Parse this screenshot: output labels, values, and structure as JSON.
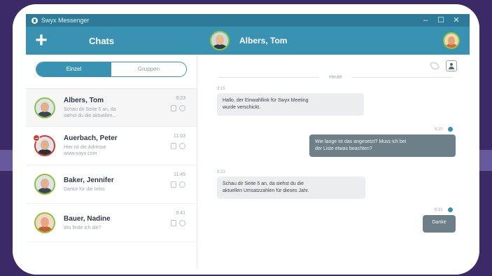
{
  "window": {
    "title": "Swyx Messenger",
    "controls": {
      "minimize": "–",
      "maximize": "☐",
      "close": "✕"
    }
  },
  "header": {
    "new_chat_icon": "plus-icon",
    "chats_label": "Chats",
    "contact_name": "Albers, Tom"
  },
  "sidebar": {
    "tabs": [
      {
        "label": "Einzel",
        "active": true
      },
      {
        "label": "Gruppen",
        "active": false
      }
    ],
    "chats": [
      {
        "name": "Albers, Tom",
        "snippet_line1": "Schau dir Seite 5 an, da",
        "snippet_line2": "siehst du die aktuellen...",
        "time": "9:23",
        "selected": true
      },
      {
        "name": "Auerbach, Peter",
        "snippet_line1": "Hier ist die Adresse",
        "snippet_line2": "www.swyx.com",
        "time": "11:03",
        "status": "do-not-disturb"
      },
      {
        "name": "Baker, Jennifer",
        "snippet_line1": "Danke für die Infos",
        "snippet_line2": "",
        "time": "11:45"
      },
      {
        "name": "Bauer, Nadine",
        "snippet_line1": "Wo finde ich die?",
        "snippet_line2": "",
        "time": "9:41"
      }
    ]
  },
  "conversation": {
    "day_label": "Heute",
    "messages": [
      {
        "direction": "in",
        "time": "9:15",
        "line1": "Hallo, der Einwahllink für Swyx Meeting",
        "line2": "wurde verschickt."
      },
      {
        "direction": "out",
        "time": "9:20",
        "line1": "Wie lange ist das angesetzt? Muss ich bei",
        "line2": "der Liste etwas beachten?"
      },
      {
        "direction": "in",
        "time": "9:23",
        "line1": "Schau dir Seite 5 an, da siehst du die",
        "line2": "aktuellen Umsatzzahlen für dieses Jahr."
      },
      {
        "direction": "out",
        "time": "9:31",
        "line1": "Danke",
        "line2": ""
      }
    ]
  },
  "colors": {
    "titlebar": "#2d7b98",
    "header": "#3a92b2",
    "accent": "#3a92b2",
    "online": "#8bc53f",
    "busy": "#d9382c",
    "background": "#3c2a66"
  }
}
